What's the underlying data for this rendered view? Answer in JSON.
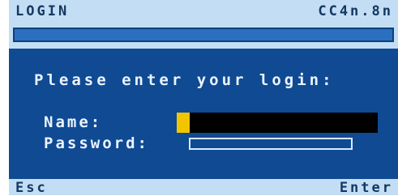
{
  "header": {
    "title": "LOGIN",
    "code": "CC4n.8n"
  },
  "progress": {
    "value": 1
  },
  "main": {
    "prompt": "Please enter your login:",
    "name_label": "Name:",
    "password_label": "Password:",
    "name_value": "",
    "password_value": ""
  },
  "footer": {
    "esc_label": "Esc",
    "enter_label": "Enter"
  },
  "colors": {
    "background": "#0f4a93",
    "header": "#c3def4",
    "cursor": "#f2c500",
    "field": "#000000"
  }
}
